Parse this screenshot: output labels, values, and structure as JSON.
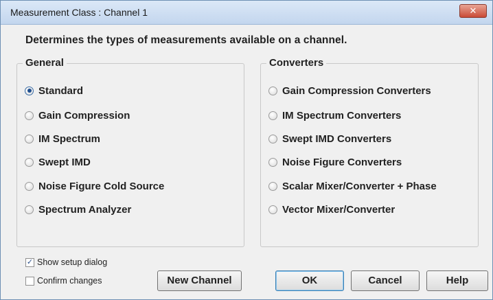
{
  "window": {
    "title": "Measurement Class : Channel 1",
    "close_symbol": "✕"
  },
  "description": "Determines the types of measurements available on a channel.",
  "general": {
    "label": "General",
    "options": [
      {
        "label": "Standard",
        "checked": true
      },
      {
        "label": "Gain Compression",
        "checked": false
      },
      {
        "label": "IM Spectrum",
        "checked": false
      },
      {
        "label": "Swept IMD",
        "checked": false
      },
      {
        "label": "Noise Figure Cold Source",
        "checked": false
      },
      {
        "label": "Spectrum Analyzer",
        "checked": false
      }
    ]
  },
  "converters": {
    "label": "Converters",
    "options": [
      {
        "label": "Gain Compression Converters",
        "checked": false
      },
      {
        "label": "IM Spectrum Converters",
        "checked": false
      },
      {
        "label": "Swept IMD Converters",
        "checked": false
      },
      {
        "label": "Noise Figure Converters",
        "checked": false
      },
      {
        "label": "Scalar Mixer/Converter + Phase",
        "checked": false
      },
      {
        "label": "Vector Mixer/Converter",
        "checked": false
      }
    ]
  },
  "checkboxes": {
    "show_setup": {
      "label": "Show setup dialog",
      "checked": true,
      "mark": "✓"
    },
    "confirm_changes": {
      "label": "Confirm changes",
      "checked": false,
      "mark": ""
    }
  },
  "buttons": {
    "new_channel": "New Channel",
    "ok": "OK",
    "cancel": "Cancel",
    "help": "Help"
  }
}
